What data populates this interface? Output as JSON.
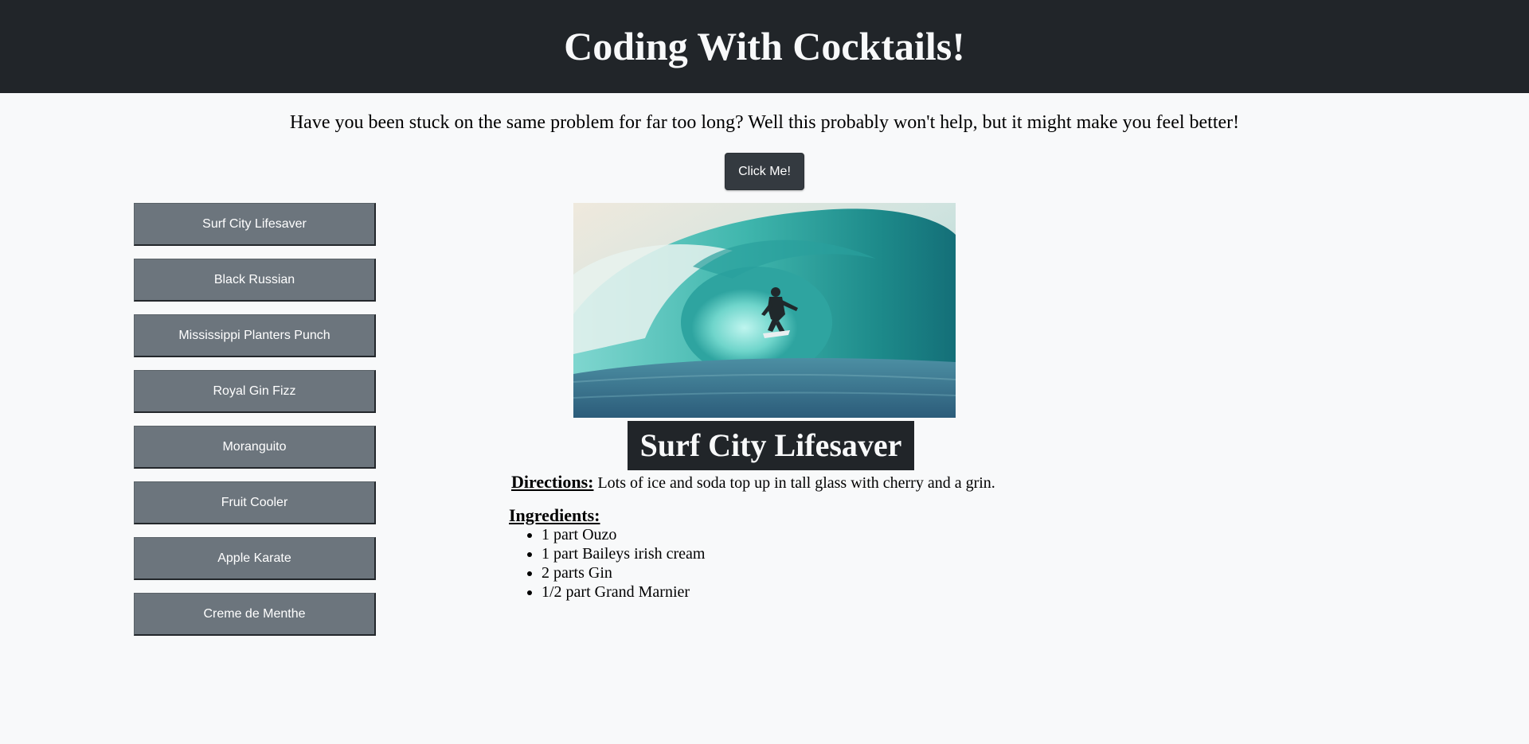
{
  "header": {
    "title": "Coding With Cocktails!"
  },
  "tagline": "Have you been stuck on the same problem for far too long? Well this probably won't help, but it might make you feel better!",
  "click_button": "Click Me!",
  "sidebar": {
    "items": [
      {
        "label": "Surf City Lifesaver"
      },
      {
        "label": "Black Russian"
      },
      {
        "label": "Mississippi Planters Punch"
      },
      {
        "label": "Royal Gin Fizz"
      },
      {
        "label": "Moranguito"
      },
      {
        "label": "Fruit Cooler"
      },
      {
        "label": "Apple Karate"
      },
      {
        "label": "Creme de Menthe"
      }
    ]
  },
  "drink": {
    "name": "Surf City Lifesaver",
    "directions_label": "Directions:",
    "directions": "Lots of ice and soda top up in tall glass with cherry and a grin.",
    "ingredients_label": "Ingredients:",
    "ingredients": [
      "1 part Ouzo",
      "1 part Baileys irish cream",
      "2 parts Gin",
      "1/2 part Grand Marnier"
    ]
  },
  "colors": {
    "header_bg": "#212529",
    "page_bg": "#f8f9fa",
    "drink_button_bg": "#6c757d",
    "click_button_bg": "#343a40"
  }
}
